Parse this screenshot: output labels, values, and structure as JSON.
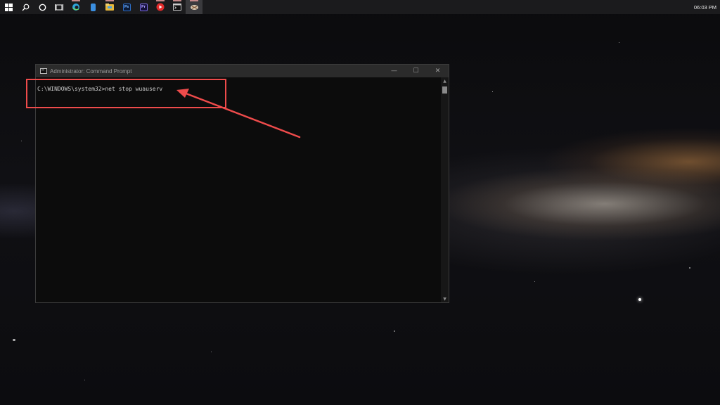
{
  "taskbar": {
    "start_icon": "windows-logo-icon",
    "search_icon": "search-icon",
    "cortana_icon": "cortana-circle-icon",
    "task_view_icon": "task-view-icon",
    "pinned_apps": [
      {
        "name": "edge-icon",
        "color": "#2fa4d8"
      },
      {
        "name": "notes-icon",
        "color": "#3b8fe0"
      },
      {
        "name": "file-explorer-icon",
        "color": "#e8b73a"
      },
      {
        "name": "photoshop-icon",
        "label": "Ps",
        "color": "#0b1a36"
      },
      {
        "name": "premiere-icon",
        "label": "Pr",
        "color": "#14103a"
      },
      {
        "name": "youtube-icon",
        "color": "#e22b2b"
      },
      {
        "name": "command-prompt-icon",
        "color": "#222222"
      },
      {
        "name": "snip-tool-icon",
        "color": "#d6c7b0"
      }
    ],
    "clock": "06:03 PM"
  },
  "cmd_window": {
    "title": "Administrator: Command Prompt",
    "minimize": "—",
    "maximize": "☐",
    "close": "✕",
    "prompt": "C:\\WINDOWS\\system32>",
    "command": "net stop wuauserv"
  },
  "annotation": {
    "color": "#ee4b4b"
  }
}
